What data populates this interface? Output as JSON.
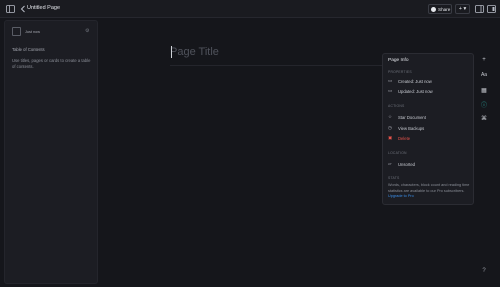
{
  "topbar": {
    "title": "Untitled Page",
    "share_label": "Share",
    "add_label": "+ ▾"
  },
  "sidebar": {
    "author_time": "Just now",
    "toc_title": "Table of Contents",
    "toc_help": "Use titles, pages or cards to create a table of contents."
  },
  "editor": {
    "title_placeholder": "Page Title"
  },
  "page_info": {
    "title": "Page Info",
    "properties_header": "PROPERTIES",
    "created": "Created: Just now",
    "updated": "Updated: Just now",
    "actions_header": "ACTIONS",
    "star": "Star Document",
    "backups": "View Backups",
    "delete": "Delete",
    "location_header": "LOCATION",
    "location": "Unsorted",
    "stats_header": "STATS",
    "stats_text": "Words, characters, block count and reading time statistics are available to our Pro subscribers.",
    "upgrade_link": "Upgrade to Pro"
  },
  "colors": {
    "background": "#15161b",
    "panel": "#1c1d23",
    "accent_link": "#3b8ee8",
    "danger": "#e5534b",
    "active_tool": "#2bb2a8"
  }
}
